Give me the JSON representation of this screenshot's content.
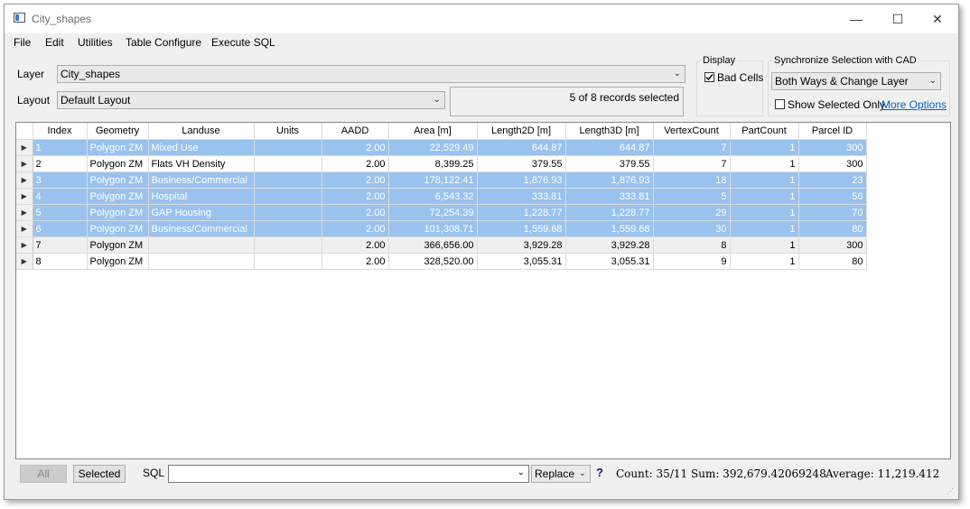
{
  "window": {
    "title": "City_shapes",
    "minimize": "—",
    "maximize": "☐",
    "close": "✕"
  },
  "menu": [
    "File",
    "Edit",
    "Utilities",
    "Table Configure",
    "Execute SQL"
  ],
  "layer": {
    "label": "Layer",
    "value": "City_shapes"
  },
  "layout": {
    "label": "Layout",
    "value": "Default Layout"
  },
  "records_status": "5 of 8 records selected",
  "display": {
    "legend": "Display",
    "bad_cells_label": "Bad Cells",
    "bad_cells_checked": true
  },
  "sync": {
    "legend": "Synchronize Selection with CAD",
    "mode": "Both Ways & Change Layer",
    "show_selected_only_label": "Show Selected Only",
    "show_selected_only_checked": false,
    "more_options": "More Options"
  },
  "table": {
    "columns": [
      "Index",
      "Geometry",
      "Landuse",
      "Units",
      "AADD",
      "Area [m]",
      "Length2D [m]",
      "Length3D [m]",
      "VertexCount",
      "PartCount",
      "Parcel ID"
    ],
    "rows": [
      {
        "selected": true,
        "cells": [
          "1",
          "Polygon ZM",
          "Mixed Use",
          "",
          "2.00",
          "22,529.49",
          "644.87",
          "644.87",
          "7",
          "1",
          "300"
        ]
      },
      {
        "selected": false,
        "cells": [
          "2",
          "Polygon ZM",
          "Flats VH Density",
          "",
          "2.00",
          "8,399.25",
          "379.55",
          "379.55",
          "7",
          "1",
          "300"
        ]
      },
      {
        "selected": true,
        "cells": [
          "3",
          "Polygon ZM",
          "Business/Commercial",
          "",
          "2.00",
          "178,122.41",
          "1,876.93",
          "1,876.93",
          "18",
          "1",
          "23"
        ]
      },
      {
        "selected": true,
        "cells": [
          "4",
          "Polygon ZM",
          "Hospital",
          "",
          "2.00",
          "6,543.32",
          "333.81",
          "333.81",
          "5",
          "1",
          "56"
        ]
      },
      {
        "selected": true,
        "cells": [
          "5",
          "Polygon ZM",
          "GAP Housing",
          "",
          "2.00",
          "72,254.39",
          "1,228.77",
          "1,228.77",
          "29",
          "1",
          "70"
        ]
      },
      {
        "selected": true,
        "cells": [
          "6",
          "Polygon ZM",
          "Business/Commercial",
          "",
          "2.00",
          "101,308.71",
          "1,559.68",
          "1,559.68",
          "30",
          "1",
          "80"
        ]
      },
      {
        "selected": false,
        "cells": [
          "7",
          "Polygon ZM",
          "",
          "",
          "2.00",
          "366,656.00",
          "3,929.28",
          "3,929.28",
          "8",
          "1",
          "300"
        ]
      },
      {
        "selected": false,
        "cells": [
          "8",
          "Polygon ZM",
          "",
          "",
          "2.00",
          "328,520.00",
          "3,055.31",
          "3,055.31",
          "9",
          "1",
          "80"
        ]
      }
    ]
  },
  "bottom": {
    "all_label": "All",
    "selected_label": "Selected",
    "sql_label": "SQL",
    "sql_value": "",
    "replace_mode": "Replace",
    "help": "?",
    "count": "Count: 35/11",
    "sum": "Sum: 392,679.42069248",
    "average": "Average: 11,219.412"
  },
  "icons": {
    "row_indicator": "triangle-right-icon",
    "dropdown": "chevron-down-icon",
    "resize": "resize-grip-icon"
  }
}
